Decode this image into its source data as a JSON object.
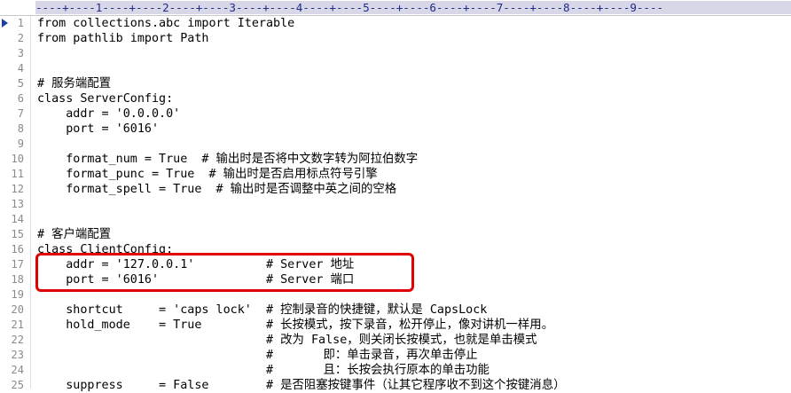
{
  "ruler": {
    "text": "----+----1----+----2----+----3----+----4----+----5----+----6----+----7----+----8----+----9----"
  },
  "editor": {
    "lines": [
      {
        "n": "1",
        "text": "from collections.abc import Iterable"
      },
      {
        "n": "2",
        "text": "from pathlib import Path"
      },
      {
        "n": "3",
        "text": ""
      },
      {
        "n": "4",
        "text": ""
      },
      {
        "n": "5",
        "text": "# 服务端配置"
      },
      {
        "n": "6",
        "text": "class ServerConfig:"
      },
      {
        "n": "7",
        "text": "    addr = '0.0.0.0'"
      },
      {
        "n": "8",
        "text": "    port = '6016'"
      },
      {
        "n": "9",
        "text": ""
      },
      {
        "n": "10",
        "text": "    format_num = True  # 输出时是否将中文数字转为阿拉伯数字"
      },
      {
        "n": "11",
        "text": "    format_punc = True  # 输出时是否启用标点符号引擎"
      },
      {
        "n": "12",
        "text": "    format_spell = True  # 输出时是否调整中英之间的空格"
      },
      {
        "n": "13",
        "text": ""
      },
      {
        "n": "14",
        "text": ""
      },
      {
        "n": "15",
        "text": "# 客户端配置"
      },
      {
        "n": "16",
        "text": "class ClientConfig:"
      },
      {
        "n": "17",
        "text": "    addr = '127.0.0.1'          # Server 地址"
      },
      {
        "n": "18",
        "text": "    port = '6016'               # Server 端口"
      },
      {
        "n": "19",
        "text": ""
      },
      {
        "n": "20",
        "text": "    shortcut     = 'caps lock'  # 控制录音的快捷键，默认是 CapsLock"
      },
      {
        "n": "21",
        "text": "    hold_mode    = True         # 长按模式，按下录音，松开停止，像对讲机一样用。"
      },
      {
        "n": "22",
        "text": "                                # 改为 False，则关闭长按模式，也就是单击模式"
      },
      {
        "n": "23",
        "text": "                                #       即：单击录音，再次单击停止"
      },
      {
        "n": "24",
        "text": "                                #       且：长按会执行原本的单击功能"
      },
      {
        "n": "25",
        "text": "    suppress     = False        # 是否阻塞按键事件（让其它程序收不到这个按键消息）"
      }
    ]
  },
  "colors": {
    "ruler_bg": "#d7d7e8",
    "ruler_text": "#1f2a8a",
    "highlight": "#e10000",
    "line_number": "#8a8a8a"
  },
  "icons": {
    "current_line_marker": "triangle-right-icon"
  }
}
